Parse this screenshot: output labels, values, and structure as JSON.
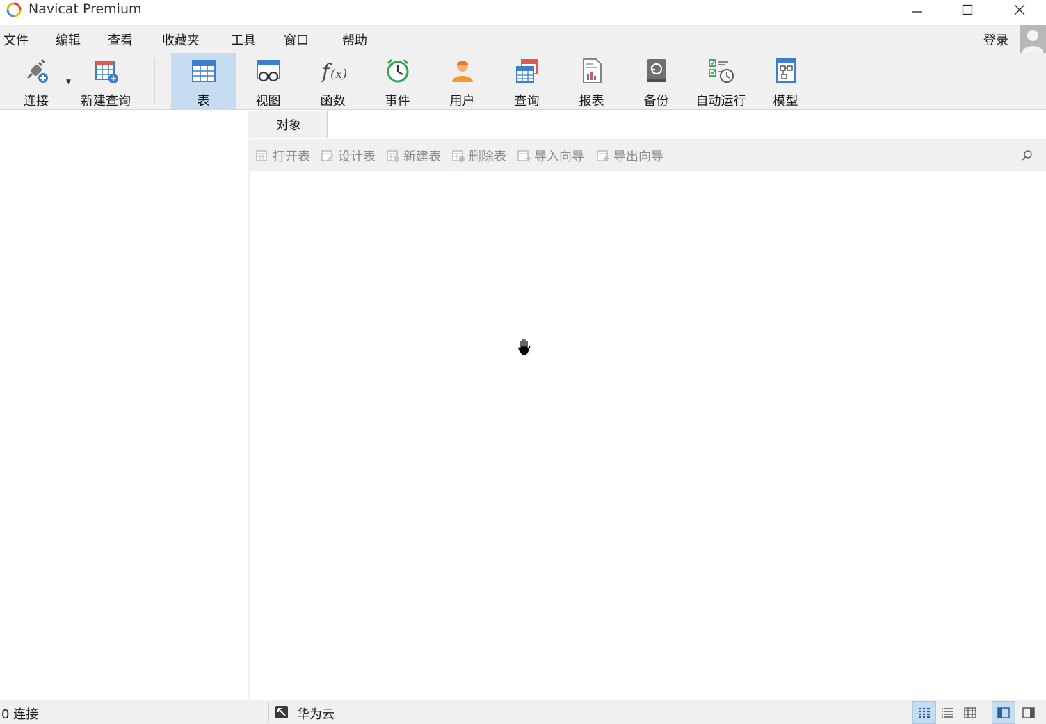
{
  "window": {
    "title": "Navicat Premium"
  },
  "menu": [
    "文件",
    "编辑",
    "查看",
    "收藏夹",
    "工具",
    "窗口",
    "帮助"
  ],
  "account": {
    "login_label": "登录"
  },
  "toolbar": {
    "items": [
      {
        "label": "连接",
        "icon": "plug-add-icon"
      },
      {
        "label": "新建查询",
        "icon": "new-query-icon"
      },
      {
        "label": "表",
        "icon": "table-icon",
        "active": true
      },
      {
        "label": "视图",
        "icon": "view-icon"
      },
      {
        "label": "函数",
        "icon": "function-icon"
      },
      {
        "label": "事件",
        "icon": "event-clock-icon"
      },
      {
        "label": "用户",
        "icon": "user-icon"
      },
      {
        "label": "查询",
        "icon": "query-icon"
      },
      {
        "label": "报表",
        "icon": "report-icon"
      },
      {
        "label": "备份",
        "icon": "backup-icon"
      },
      {
        "label": "自动运行",
        "icon": "automation-icon"
      },
      {
        "label": "模型",
        "icon": "model-icon"
      }
    ]
  },
  "tabs": [
    {
      "label": "对象"
    }
  ],
  "object_toolbar": {
    "buttons": [
      {
        "label": "打开表",
        "icon": "open-table-icon"
      },
      {
        "label": "设计表",
        "icon": "design-table-icon"
      },
      {
        "label": "新建表",
        "icon": "new-table-icon"
      },
      {
        "label": "删除表",
        "icon": "delete-table-icon"
      },
      {
        "label": "导入向导",
        "icon": "import-wizard-icon"
      },
      {
        "label": "导出向导",
        "icon": "export-wizard-icon"
      }
    ]
  },
  "status": {
    "connections": "0 连接",
    "cloud": "华为云"
  },
  "colors": {
    "active_bg": "#c6dcf0",
    "chrome_bg": "#f0f0f0",
    "icon_blue": "#3d7fcf",
    "disabled_text": "#8d8d8d"
  }
}
